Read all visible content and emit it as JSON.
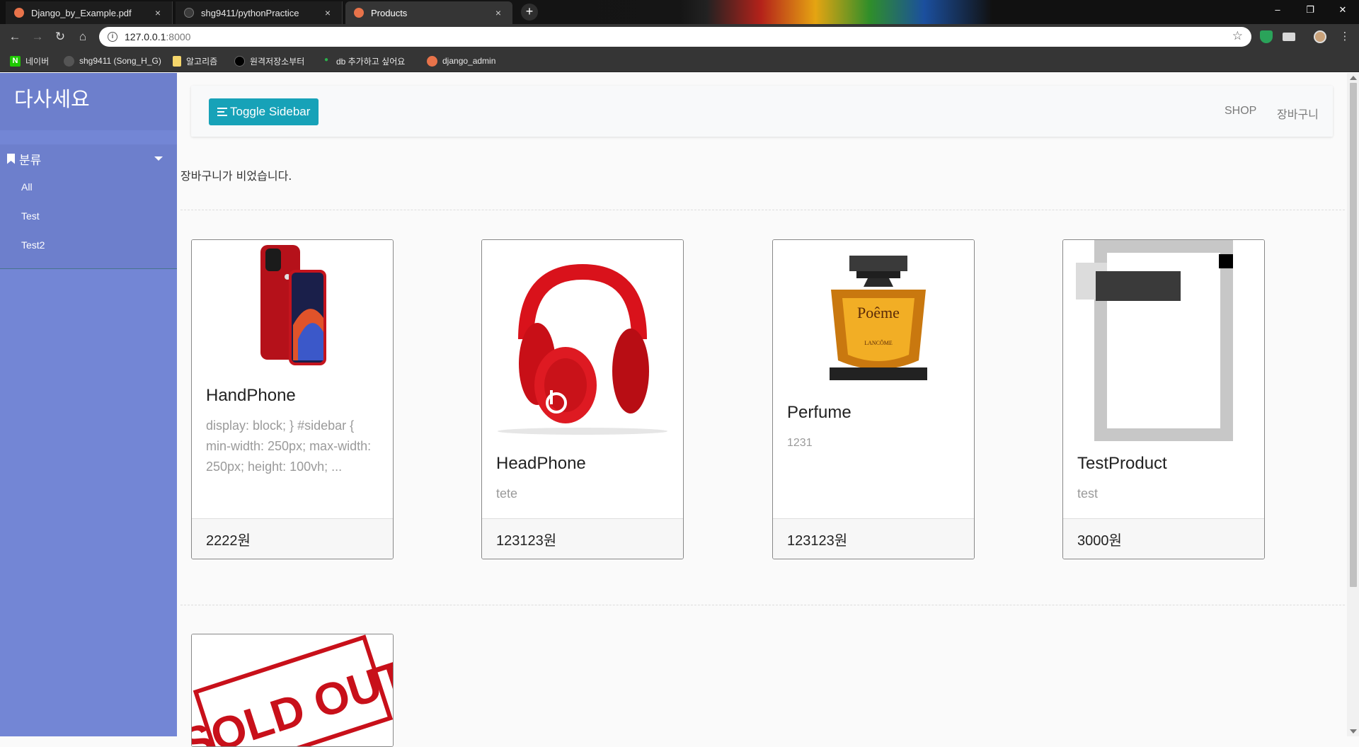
{
  "browser": {
    "tabs": [
      {
        "title": "Django_by_Example.pdf",
        "close": "×"
      },
      {
        "title": "shg9411/pythonPractice",
        "close": "×"
      },
      {
        "title": "Products",
        "close": "×"
      }
    ],
    "new_tab": "+",
    "window": {
      "minimize": "–",
      "restore": "❐",
      "close": "✕"
    },
    "address": {
      "host": "127.0.0.1",
      "port": ":8000"
    },
    "bookmarks": [
      "네이버",
      "shg9411 (Song_H_G)",
      "알고리즘",
      "원격저장소부터",
      "db 추가하고 싶어요",
      "django_admin"
    ]
  },
  "sidebar": {
    "brand": "다사세요",
    "category_label": "분류",
    "categories": [
      "All",
      "Test",
      "Test2"
    ]
  },
  "navbar": {
    "toggle_label": "Toggle Sidebar",
    "links": [
      "SHOP",
      "장바구니"
    ]
  },
  "cart_message": "장바구니가 비었습니다.",
  "products": [
    {
      "name": "HandPhone",
      "description": "display: block; } #sidebar { min-width: 250px; max-width: 250px; height: 100vh; ...",
      "price": "2222원"
    },
    {
      "name": "HeadPhone",
      "description": "tete",
      "price": "123123원"
    },
    {
      "name": "Perfume",
      "description": "1231",
      "price": "123123원"
    },
    {
      "name": "TestProduct",
      "description": "test",
      "price": "3000원"
    }
  ],
  "sold_out_text": "SOLD OUT",
  "perfume_label": "Poême",
  "perfume_brand": "LANCÔME",
  "colors": {
    "sidebar": "#7386d5",
    "sidebar_dark": "#6d7fcc",
    "toggle_button": "#17a2b8",
    "page_bg": "#fafafa"
  }
}
